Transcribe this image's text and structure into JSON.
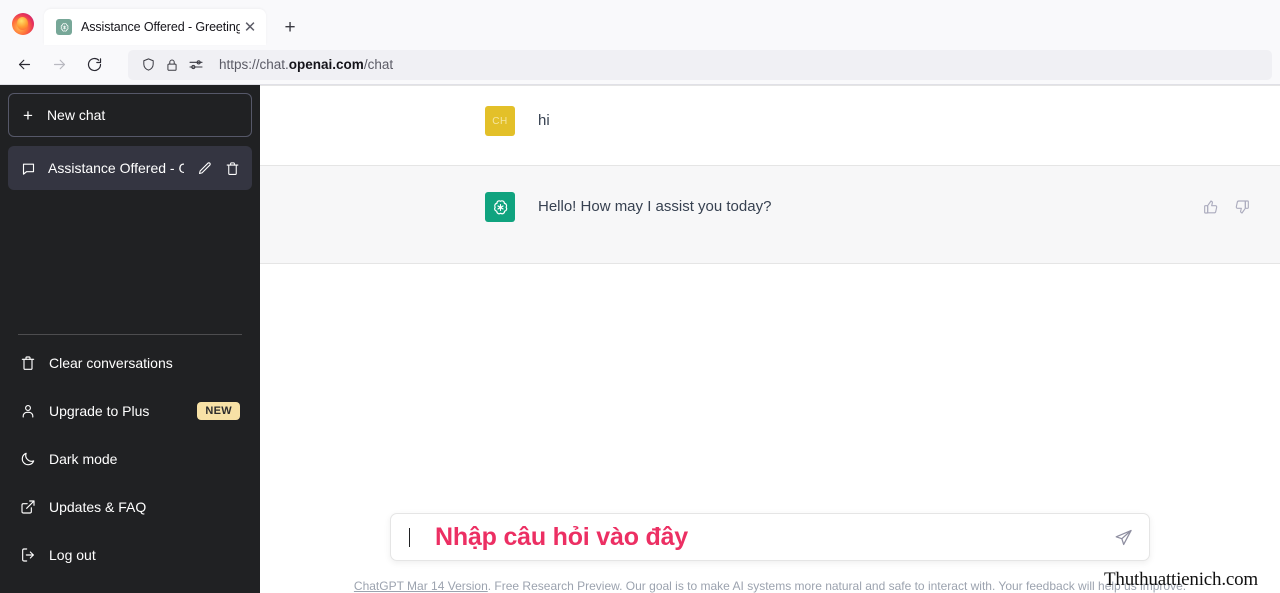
{
  "browser": {
    "tab": {
      "title": "Assistance Offered - Greeting.",
      "favicon_name": "openai-favicon",
      "close_label": "✕"
    },
    "new_tab_label": "+",
    "nav": {
      "back_label": "back-arrow",
      "forward_label": "forward-arrow",
      "reload_label": "reload"
    },
    "url": {
      "protocol": "https://chat.",
      "domain": "openai.com",
      "path": "/chat",
      "full": "https://chat.openai.com/chat",
      "icons": [
        "shield-icon",
        "lock-icon",
        "permissions-icon"
      ]
    }
  },
  "sidebar": {
    "new_chat_label": "New chat",
    "conversations": [
      {
        "title": "Assistance Offered - Gr",
        "icon": "chat-bubble-icon",
        "edit_icon": "pencil-icon",
        "delete_icon": "trash-icon",
        "active": true
      }
    ],
    "menu": [
      {
        "label": "Clear conversations",
        "icon": "trash-icon",
        "badge": ""
      },
      {
        "label": "Upgrade to Plus",
        "icon": "person-icon",
        "badge": "NEW"
      },
      {
        "label": "Dark mode",
        "icon": "moon-icon",
        "badge": ""
      },
      {
        "label": "Updates & FAQ",
        "icon": "external-link-icon",
        "badge": ""
      },
      {
        "label": "Log out",
        "icon": "logout-icon",
        "badge": ""
      }
    ],
    "colors": {
      "background": "#202123",
      "active_item": "#343541",
      "badge": "#f7e1a6"
    }
  },
  "chat": {
    "messages": [
      {
        "role": "user",
        "avatar_text": "CH",
        "avatar_color": "#e3c029",
        "text": "hi",
        "has_actions": false
      },
      {
        "role": "assistant",
        "avatar_text": "",
        "avatar_color": "#10a37f",
        "text": "Hello! How may I assist you today?",
        "has_actions": true,
        "thumbs_up_icon": "thumbs-up-icon",
        "thumbs_down_icon": "thumbs-down-icon"
      }
    ]
  },
  "composer": {
    "value": "",
    "placeholder": "",
    "overlay_text": "Nhập câu hỏi vào đây",
    "overlay_color": "#ec2f63",
    "send_icon": "send-paper-plane-icon"
  },
  "footer": {
    "link_text": "ChatGPT Mar 14 Version",
    "rest_text": ". Free Research Preview. Our goal is to make AI systems more natural and safe to interact with. Your feedback will help us improve."
  },
  "watermark": {
    "text": "Thuthuattienich.com"
  }
}
